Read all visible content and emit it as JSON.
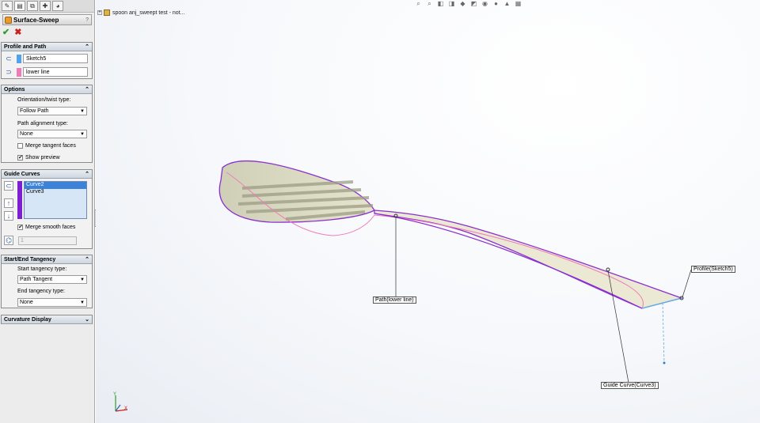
{
  "feature": {
    "title": "Surface-Sweep",
    "help": "?",
    "ok": "✔",
    "cancel": "✖"
  },
  "tabs": [
    "feature-manager",
    "property-manager",
    "configuration-manager",
    "dim-xpert-manager",
    "display-manager"
  ],
  "profile_path": {
    "heading": "Profile and Path",
    "profile": "Sketch5",
    "path": "lower line",
    "profile_color": "#4da3ee",
    "path_color": "#f07ab8"
  },
  "options": {
    "heading": "Options",
    "orientation_label": "Orientation/twist type:",
    "orientation_value": "Follow Path",
    "alignment_label": "Path alignment type:",
    "alignment_value": "None",
    "merge_tangent": "Merge tangent faces",
    "show_preview": "Show preview",
    "merge_tangent_checked": "",
    "show_preview_checked": "✔"
  },
  "guide_curves": {
    "heading": "Guide Curves",
    "items": [
      "Curve2",
      "Curve3"
    ],
    "merge_smooth": "Merge smooth faces",
    "merge_smooth_checked": "✔",
    "spin_value": "1",
    "list_color": "#7b1fd0"
  },
  "tangency": {
    "heading": "Start/End Tangency",
    "start_label": "Start tangency type:",
    "start_value": "Path Tangent",
    "end_label": "End tangency type:",
    "end_value": "None"
  },
  "curvature": {
    "heading": "Curvature Display"
  },
  "tree": {
    "part_name": "spoon anj_sweept test - not..."
  },
  "callouts": {
    "path": "Path(lower line)",
    "profile": "Profile(Sketch5)",
    "guide": "Guide Curve(Curve3)"
  },
  "triad": {
    "x": "X",
    "y": "Y"
  }
}
